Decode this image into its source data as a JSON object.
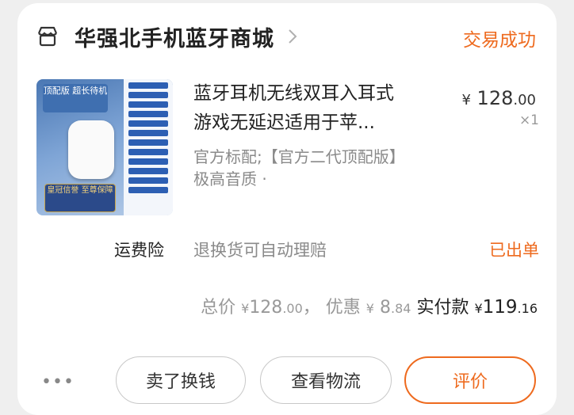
{
  "shop": {
    "name": "华强北手机蓝牙商城",
    "status": "交易成功"
  },
  "product": {
    "title_line1": "蓝牙耳机无线双耳入耳式",
    "title_line2": "游戏无延迟适用于苹...",
    "specs_line1": "官方标配;【官方二代顶配版】",
    "specs_line2": "极高音质 ·",
    "price_symbol": "¥",
    "price_int": "128",
    "price_dec": ".00",
    "quantity": "×1",
    "thumb_tag": "顶配版 超长待机",
    "thumb_badge": "皇冠信誉 至尊保障"
  },
  "insurance": {
    "label": "运费险",
    "desc": "退换货可自动理赔",
    "status": "已出单"
  },
  "totals": {
    "total_label": "总价",
    "total_symbol": "¥",
    "total_int": "128",
    "total_dec": ".00",
    "sep": "，",
    "discount_label": "优惠",
    "discount_symbol": "¥",
    "discount_int": "8",
    "discount_dec": ".84",
    "paid_label": "实付款",
    "paid_symbol": "¥",
    "paid_int": "119",
    "paid_dec": ".16"
  },
  "actions": {
    "more": "•••",
    "sell": "卖了换钱",
    "logistics": "查看物流",
    "review": "评价"
  },
  "colors": {
    "accent": "#ee6a1e"
  },
  "icons": {
    "shop": "shop-icon",
    "chevron": "chevron-right-icon"
  }
}
